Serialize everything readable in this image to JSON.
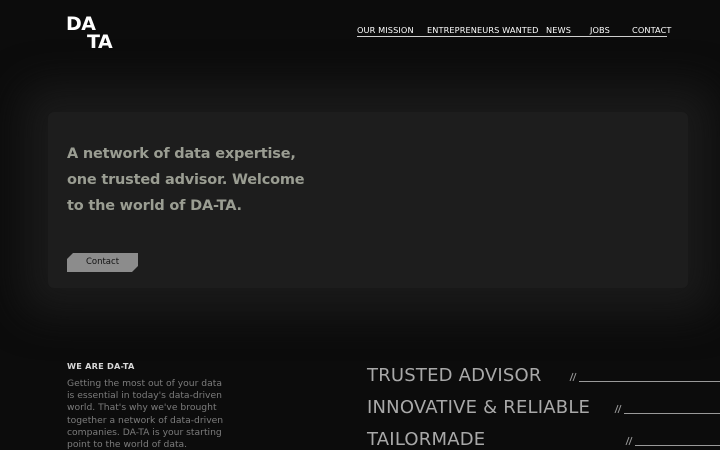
{
  "header": {
    "logo": {
      "line1": "DA",
      "line2": "TA"
    },
    "nav": [
      {
        "label": "OUR MISSION"
      },
      {
        "label": "ENTREPRENEURS WANTED"
      },
      {
        "label": "NEWS"
      },
      {
        "label": "JOBS"
      },
      {
        "label": "CONTACT"
      }
    ]
  },
  "hero": {
    "title_lines": [
      "A network of data expertise,",
      "one trusted advisor. Welcome",
      "to the world of DA-TA."
    ],
    "button_label": "Contact"
  },
  "about": {
    "heading": "WE ARE DA-TA",
    "body_lines": [
      "Getting the most out of your data",
      "is essential in today's data-driven",
      "world. That's why we've brought",
      "together a network of data-driven",
      "companies. DA-TA is your starting",
      "point to the world of data."
    ]
  },
  "features": [
    {
      "label": "TRUSTED ADVISOR"
    },
    {
      "label": "INNOVATIVE & RELIABLE"
    },
    {
      "label": "TAILORMADE"
    }
  ],
  "colors": {
    "background": "#0c0c0c",
    "hero_panel": "#1d1d1d",
    "hero_text": "#9a9d92",
    "button": "#8c8c8c"
  }
}
